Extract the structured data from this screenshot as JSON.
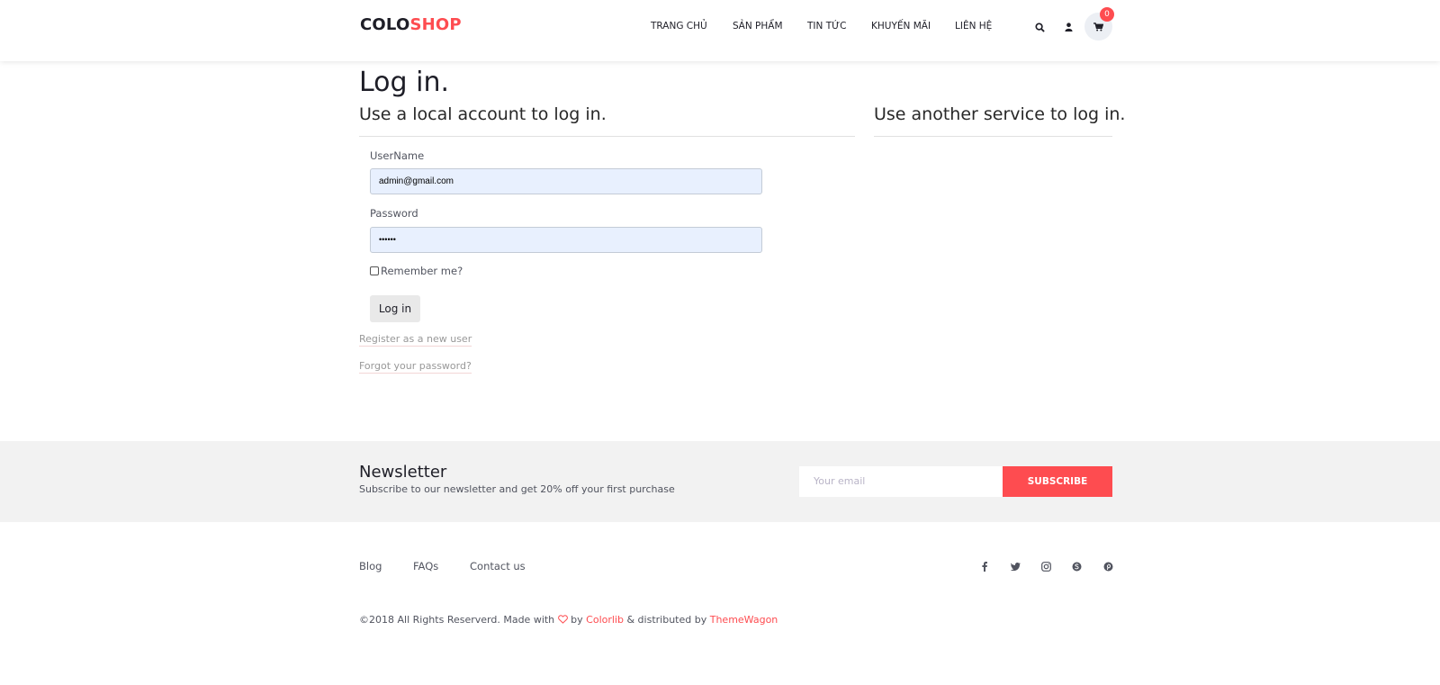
{
  "header": {
    "logo_part1": "COLO",
    "logo_part2": "SHOP",
    "nav": [
      "TRANG CHỦ",
      "SẢN PHẨM",
      "TIN TỨC",
      "KHUYẾN MÃI",
      "LIÊN HỆ"
    ],
    "icons": [
      "search-icon",
      "user-icon",
      "cart-icon"
    ],
    "cart_count": "0"
  },
  "main": {
    "title": "Log in.",
    "local_heading": "Use a local account to log in.",
    "external_heading": "Use another service to log in.",
    "username_label": "UserName",
    "username_value": "admin@gmail.com",
    "password_label": "Password",
    "password_value": "••••••",
    "remember_label": "Remember me?",
    "login_button": "Log in",
    "register_link": "Register as a new user",
    "forgot_link": "Forgot your password?"
  },
  "newsletter": {
    "title": "Newsletter",
    "subtitle": "Subscribe to our newsletter and get 20% off your first purchase",
    "email_placeholder": "Your email",
    "subscribe_button": "SUBSCRIBE"
  },
  "footer": {
    "links": [
      "Blog",
      "FAQs",
      "Contact us"
    ],
    "social_icons": [
      "facebook-icon",
      "twitter-icon",
      "instagram-icon",
      "skype-icon",
      "pinterest-icon"
    ],
    "copyright_prefix": "©2018 All Rights Reserverd. Made with",
    "copyright_by": "by",
    "colorlib": "Colorlib",
    "distributed": "& distributed by",
    "themewagon": "ThemeWagon"
  },
  "colors": {
    "accent": "#fe4c50",
    "text_dark": "#1e1e27",
    "input_bg": "#e8f0fe",
    "newsletter_bg": "#f2f2f2"
  }
}
